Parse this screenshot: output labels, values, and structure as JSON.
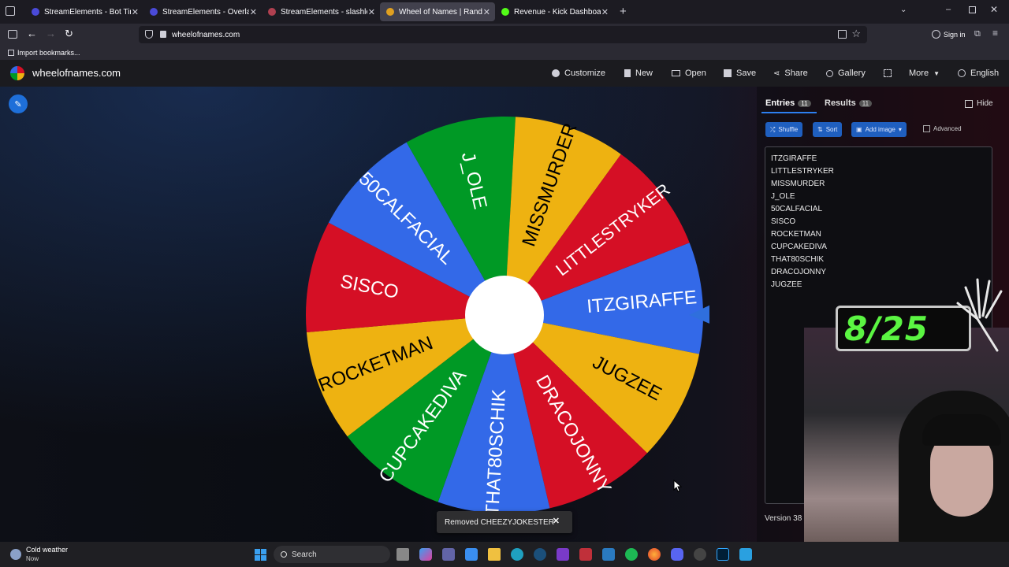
{
  "browser": {
    "tabs": [
      {
        "label": "StreamElements - Bot Timers",
        "color": "#4a4ad8"
      },
      {
        "label": "StreamElements - Overlays",
        "color": "#4a4ad8"
      },
      {
        "label": "StreamElements - slashley",
        "color": "#b04050"
      },
      {
        "label": "Wheel of Names | Random",
        "color": "#e0a020",
        "active": true
      },
      {
        "label": "Revenue - Kick Dashboard",
        "color": "#53fc18"
      }
    ],
    "url": "wheelofnames.com",
    "sign_in": "Sign in",
    "bookmark": "Import bookmarks..."
  },
  "site": {
    "logo": "wheelofnames.com",
    "menu": {
      "customize": "Customize",
      "new": "New",
      "open": "Open",
      "save": "Save",
      "share": "Share",
      "gallery": "Gallery",
      "more": "More",
      "language": "English"
    }
  },
  "wheel": {
    "segments": [
      {
        "label": "ITZGIRAFFE",
        "color": "#3369e8"
      },
      {
        "label": "JUGZEE",
        "color": "#eeb211"
      },
      {
        "label": "DRACOJONNY",
        "color": "#d50f25"
      },
      {
        "label": "THAT80SCHIK",
        "color": "#3369e8"
      },
      {
        "label": "CUPCAKEDIVA",
        "color": "#009925"
      },
      {
        "label": "ROCKETMAN",
        "color": "#eeb211"
      },
      {
        "label": "SISCO",
        "color": "#d50f25"
      },
      {
        "label": "50CALFACIAL",
        "color": "#3369e8"
      },
      {
        "label": "J_OLE",
        "color": "#009925"
      },
      {
        "label": "MISSMURDER",
        "color": "#eeb211"
      },
      {
        "label": "LITTLESTRYKER",
        "color": "#d50f25"
      }
    ]
  },
  "sidebar": {
    "entries_tab": "Entries",
    "entries_count": "11",
    "results_tab": "Results",
    "results_count": "11",
    "hide": "Hide",
    "shuffle": "Shuffle",
    "sort": "Sort",
    "add_image": "Add image",
    "advanced": "Advanced",
    "entries": [
      "ITZGIRAFFE",
      "LITTLESTRYKER",
      "MISSMURDER",
      "J_OLE",
      "50CALFACIAL",
      "SISCO",
      "ROCKETMAN",
      "CUPCAKEDIVA",
      "THAT80SCHIK",
      "DRACOJONNY",
      "JUGZEE"
    ],
    "version": "Version 38"
  },
  "toast": {
    "text": "Removed CHEEZYJOKESTER"
  },
  "overlay": {
    "counter": "8/25"
  },
  "taskbar": {
    "weather_title": "Cold weather",
    "weather_sub": "Now",
    "search": "Search"
  }
}
